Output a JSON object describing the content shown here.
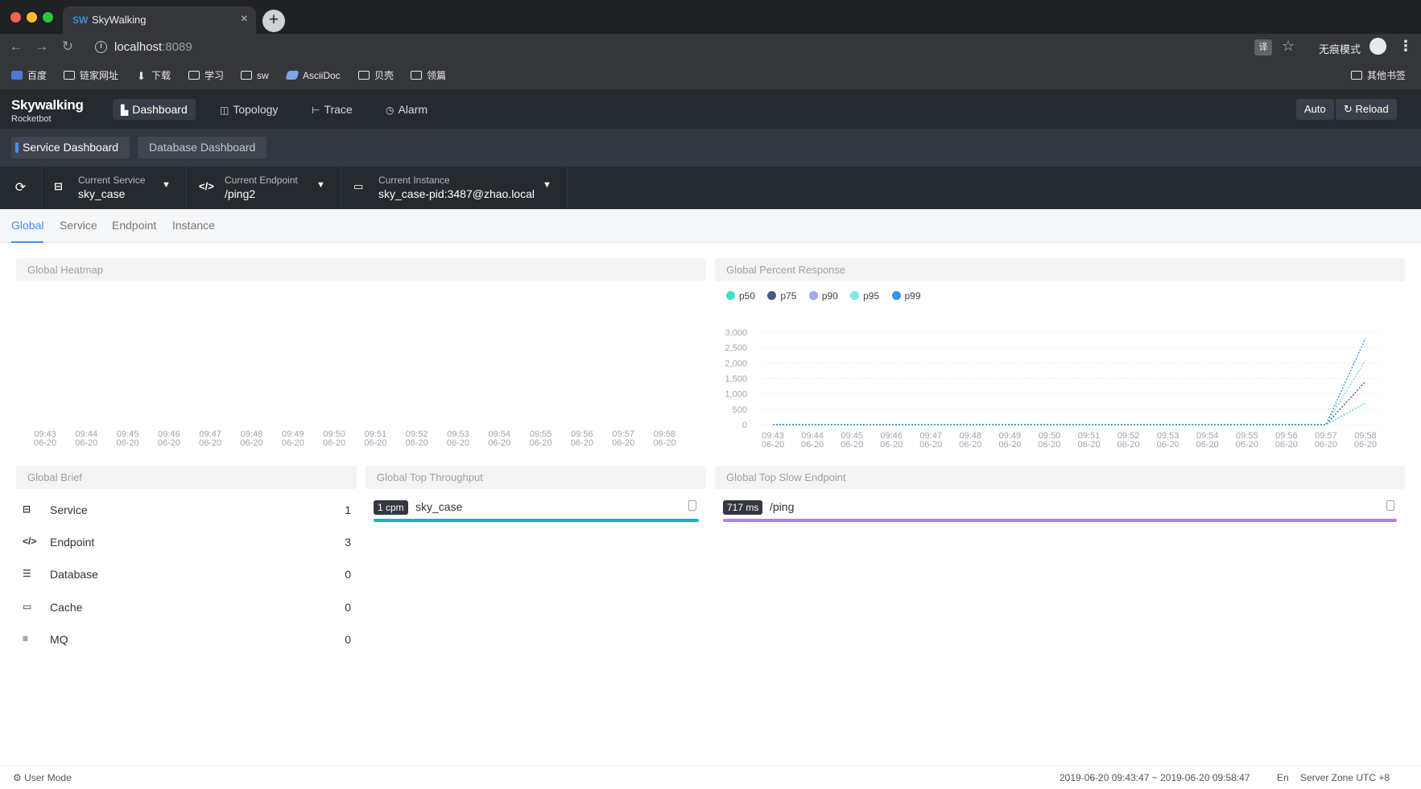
{
  "browser": {
    "tab_title": "SkyWalking",
    "url_host": "localhost",
    "url_port": ":8089",
    "translate_label": "译",
    "incognito_label": "无痕模式",
    "bookmarks": [
      {
        "label": "百度",
        "icon": "baidu-icon"
      },
      {
        "label": "链家网址",
        "icon": "folder-icon"
      },
      {
        "label": "下载",
        "icon": "download-icon"
      },
      {
        "label": "学习",
        "icon": "folder-icon"
      },
      {
        "label": "sw",
        "icon": "folder-icon"
      },
      {
        "label": "AsciiDoc",
        "icon": "asciidoc-icon"
      },
      {
        "label": "贝壳",
        "icon": "folder-icon"
      },
      {
        "label": "领篇",
        "icon": "folder-icon"
      }
    ],
    "other_bookmarks": "其他书签"
  },
  "app": {
    "logo": "Skywalking",
    "logo_sub": "Rocketbot",
    "nav": [
      {
        "label": "Dashboard",
        "icon": "bar-chart-icon",
        "active": true
      },
      {
        "label": "Topology",
        "icon": "topology-icon",
        "active": false
      },
      {
        "label": "Trace",
        "icon": "trace-icon",
        "active": false
      },
      {
        "label": "Alarm",
        "icon": "alarm-icon",
        "active": false
      }
    ],
    "auto_label": "Auto",
    "reload_label": "Reload"
  },
  "dashboards": [
    "Service Dashboard",
    "Database Dashboard"
  ],
  "selectors": {
    "service": {
      "label": "Current Service",
      "value": "sky_case"
    },
    "endpoint": {
      "label": "Current Endpoint",
      "value": "/ping2"
    },
    "instance": {
      "label": "Current Instance",
      "value": "sky_case-pid:3487@zhao.local"
    }
  },
  "subtabs": [
    "Global",
    "Service",
    "Endpoint",
    "Instance"
  ],
  "heatmap": {
    "title": "Global Heatmap",
    "times": [
      "09:43",
      "09:44",
      "09:45",
      "09:46",
      "09:47",
      "09:48",
      "09:49",
      "09:50",
      "09:51",
      "09:52",
      "09:53",
      "09:54",
      "09:55",
      "09:56",
      "09:57",
      "09:58"
    ],
    "date": "06-20"
  },
  "percent_response": {
    "title": "Global Percent Response",
    "legend": [
      {
        "name": "p50",
        "color": "#3fe1c0"
      },
      {
        "name": "p75",
        "color": "#4b5a82"
      },
      {
        "name": "p90",
        "color": "#a3a6f0"
      },
      {
        "name": "p95",
        "color": "#77ebe4"
      },
      {
        "name": "p99",
        "color": "#3594e8"
      }
    ],
    "yticks": [
      "3,000",
      "2,500",
      "2,000",
      "1,500",
      "1,000",
      "500",
      "0"
    ]
  },
  "chart_data": {
    "type": "line",
    "title": "Global Percent Response",
    "x": [
      "09:43",
      "09:44",
      "09:45",
      "09:46",
      "09:47",
      "09:48",
      "09:49",
      "09:50",
      "09:51",
      "09:52",
      "09:53",
      "09:54",
      "09:55",
      "09:56",
      "09:57",
      "09:58"
    ],
    "ylim": [
      0,
      3000
    ],
    "grid": true,
    "legend": "top-left",
    "series": [
      {
        "name": "p50",
        "values": [
          0,
          0,
          0,
          0,
          0,
          0,
          0,
          0,
          0,
          0,
          0,
          0,
          0,
          0,
          0,
          700
        ]
      },
      {
        "name": "p75",
        "values": [
          0,
          0,
          0,
          0,
          0,
          0,
          0,
          0,
          0,
          0,
          0,
          0,
          0,
          0,
          0,
          1400
        ]
      },
      {
        "name": "p90",
        "values": [
          0,
          0,
          0,
          0,
          0,
          0,
          0,
          0,
          0,
          0,
          0,
          0,
          0,
          0,
          0,
          2100
        ]
      },
      {
        "name": "p95",
        "values": [
          0,
          0,
          0,
          0,
          0,
          0,
          0,
          0,
          0,
          0,
          0,
          0,
          0,
          0,
          0,
          2100
        ]
      },
      {
        "name": "p99",
        "values": [
          0,
          0,
          0,
          0,
          0,
          0,
          0,
          0,
          0,
          0,
          0,
          0,
          0,
          0,
          0,
          2800
        ]
      }
    ]
  },
  "brief": {
    "title": "Global Brief",
    "items": [
      {
        "label": "Service",
        "value": "1",
        "icon": "service-icon"
      },
      {
        "label": "Endpoint",
        "value": "3",
        "icon": "endpoint-icon"
      },
      {
        "label": "Database",
        "value": "0",
        "icon": "database-icon"
      },
      {
        "label": "Cache",
        "value": "0",
        "icon": "cache-icon"
      },
      {
        "label": "MQ",
        "value": "0",
        "icon": "mq-icon"
      }
    ]
  },
  "throughput": {
    "title": "Global Top Throughput",
    "items": [
      {
        "badge": "1 cpm",
        "name": "sky_case",
        "color": "#1ab1c8",
        "fraction": 1.0
      }
    ]
  },
  "slow_endpoint": {
    "title": "Global Top Slow Endpoint",
    "items": [
      {
        "badge": "717 ms",
        "name": "/ping",
        "color": "#b07ff0",
        "fraction": 1.0
      }
    ]
  },
  "footer": {
    "user_mode": "User Mode",
    "time_range": "2019-06-20 09:43:47 ~ 2019-06-20 09:58:47",
    "lang": "En",
    "zone": "Server Zone UTC +8"
  }
}
